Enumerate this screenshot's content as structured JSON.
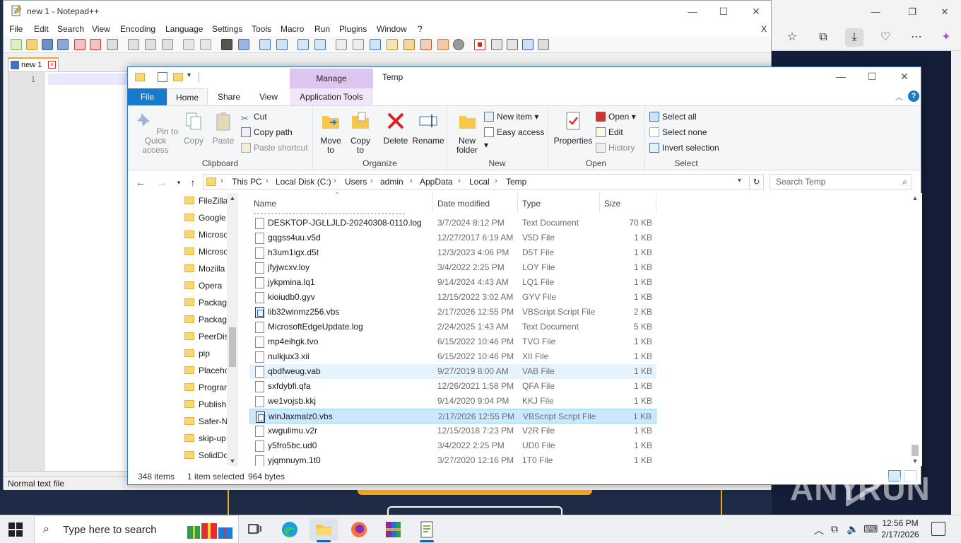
{
  "notepad": {
    "title": "new 1 - Notepad++",
    "menu": [
      "File",
      "Edit",
      "Search",
      "View",
      "Encoding",
      "Language",
      "Settings",
      "Tools",
      "Macro",
      "Run",
      "Plugins",
      "Window",
      "?"
    ],
    "close_doc_label": "X",
    "tab_label": "new 1",
    "line_number": "1",
    "status": "Normal text file"
  },
  "explorer": {
    "title": "Temp",
    "contextual_tab_group": "Manage",
    "tabs": [
      "File",
      "Home",
      "Share",
      "View",
      "Application Tools"
    ],
    "ribbon": {
      "clipboard": {
        "label": "Clipboard",
        "pin": "Pin to Quick access",
        "copy": "Copy",
        "paste": "Paste",
        "cut": "Cut",
        "copy_path": "Copy path",
        "paste_shortcut": "Paste shortcut"
      },
      "organize": {
        "label": "Organize",
        "move_to": "Move to",
        "copy_to": "Copy to",
        "delete": "Delete",
        "rename": "Rename"
      },
      "new": {
        "label": "New",
        "new_folder": "New folder",
        "new_item": "New item",
        "easy_access": "Easy access"
      },
      "open": {
        "label": "Open",
        "properties": "Properties",
        "open": "Open",
        "edit": "Edit",
        "history": "History"
      },
      "select": {
        "label": "Select",
        "select_all": "Select all",
        "select_none": "Select none",
        "invert": "Invert selection"
      }
    },
    "breadcrumb": [
      "This PC",
      "Local Disk (C:)",
      "Users",
      "admin",
      "AppData",
      "Local",
      "Temp"
    ],
    "search_placeholder": "Search Temp",
    "nav_items": [
      "FileZilla",
      "Google",
      "Microso",
      "Microso",
      "Mozilla",
      "Opera",
      "Packag",
      "Packag",
      "PeerDis",
      "pip",
      "Placeho",
      "Progran",
      "Publish",
      "Safer-N",
      "skip-up",
      "SolidDo"
    ],
    "columns": {
      "name": "Name",
      "date": "Date modified",
      "type": "Type",
      "size": "Size"
    },
    "files": [
      {
        "name": "DESKTOP-JGLLJLD-20240308-0110.log",
        "date": "3/7/2024 8:12 PM",
        "type": "Text Document",
        "size": "70 KB"
      },
      {
        "name": "gqgss4uu.v5d",
        "date": "12/27/2017 6:19 AM",
        "type": "V5D File",
        "size": "1 KB"
      },
      {
        "name": "h3um1igx.d5t",
        "date": "12/3/2023 4:06 PM",
        "type": "D5T File",
        "size": "1 KB"
      },
      {
        "name": "jfyjwcxv.loy",
        "date": "3/4/2022 2:25 PM",
        "type": "LOY File",
        "size": "1 KB"
      },
      {
        "name": "jykpmina.lq1",
        "date": "9/14/2024 4:43 AM",
        "type": "LQ1 File",
        "size": "1 KB"
      },
      {
        "name": "kioiudb0.gyv",
        "date": "12/15/2022 3:02 AM",
        "type": "GYV File",
        "size": "1 KB"
      },
      {
        "name": "lib32winmz256.vbs",
        "date": "2/17/2026 12:55 PM",
        "type": "VBScript Script File",
        "size": "2 KB"
      },
      {
        "name": "MicrosoftEdgeUpdate.log",
        "date": "2/24/2025 1:43 AM",
        "type": "Text Document",
        "size": "5 KB"
      },
      {
        "name": "mp4eihgk.tvo",
        "date": "6/15/2022 10:46 PM",
        "type": "TVO File",
        "size": "1 KB"
      },
      {
        "name": "nulkjux3.xii",
        "date": "6/15/2022 10:46 PM",
        "type": "XII File",
        "size": "1 KB"
      },
      {
        "name": "qbdfweug.vab",
        "date": "9/27/2019 8:00 AM",
        "type": "VAB File",
        "size": "1 KB"
      },
      {
        "name": "sxfdybfi.qfa",
        "date": "12/26/2021 1:58 PM",
        "type": "QFA File",
        "size": "1 KB"
      },
      {
        "name": "we1vojsb.kkj",
        "date": "9/14/2020 9:04 PM",
        "type": "KKJ File",
        "size": "1 KB"
      },
      {
        "name": "winJaxmalz0.vbs",
        "date": "2/17/2026 12:55 PM",
        "type": "VBScript Script File",
        "size": "1 KB"
      },
      {
        "name": "xwgulimu.v2r",
        "date": "12/15/2018 7:23 PM",
        "type": "V2R File",
        "size": "1 KB"
      },
      {
        "name": "y5fro5bc.ud0",
        "date": "3/4/2022 2:25 PM",
        "type": "UD0 File",
        "size": "1 KB"
      },
      {
        "name": "yjqmnuym.1t0",
        "date": "3/27/2020 12:16 PM",
        "type": "1T0 File",
        "size": "1 KB"
      }
    ],
    "status": {
      "items": "348 items",
      "selected": "1 item selected",
      "size": "964 bytes"
    }
  },
  "taskbar": {
    "search_placeholder": "Type here to search",
    "time": "12:56 PM",
    "date": "2/17/2026"
  },
  "watermark": {
    "left": "ANY",
    "right": "RUN"
  },
  "colors": {
    "accent": "#1979ca",
    "selection": "#cce8ff",
    "manage_tab": "#dfc6f1",
    "highlight_orange": "#f6a61b"
  }
}
